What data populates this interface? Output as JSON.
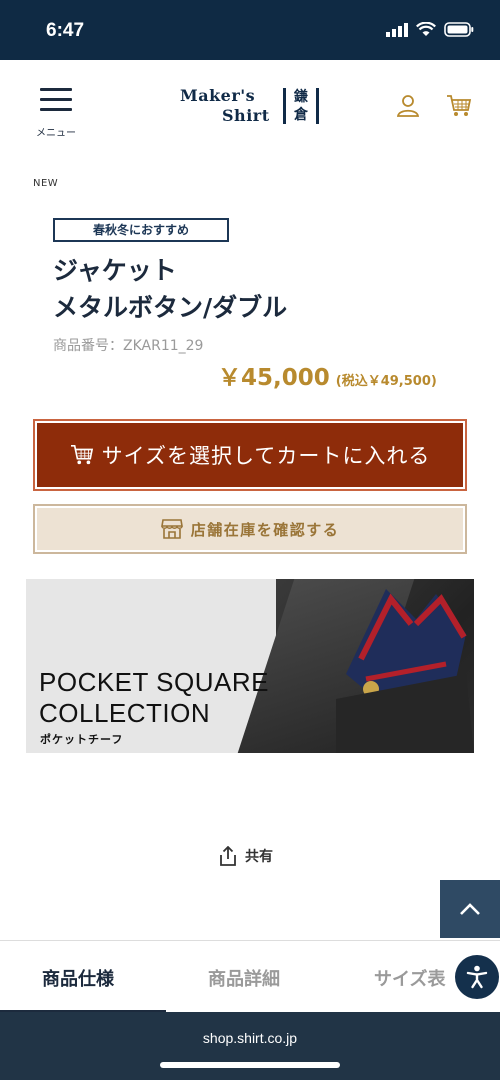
{
  "status_bar": {
    "time": "6:47"
  },
  "header": {
    "menu_label": "メニュー",
    "logo_line1": "Maker's",
    "logo_line2": "Shirt",
    "logo_kanji1": "鎌",
    "logo_kanji2": "倉"
  },
  "product": {
    "tag": "NEW",
    "season_badge": "春秋冬におすすめ",
    "title_line1": "ジャケット",
    "title_line2": "メタルボタン/ダブル",
    "code": "商品番号：ZKAR11_29",
    "price": "￥45,000",
    "price_tax": "(税込￥49,500)"
  },
  "buttons": {
    "add_to_cart": "サイズを選択してカートに入れる",
    "store_stock": "店舗在庫を確認する"
  },
  "banner": {
    "headline_line1": "POCKET SQUARE",
    "headline_line2": "COLLECTION",
    "sub": "ポケットチーフ"
  },
  "share": {
    "label": "共有"
  },
  "tabs": [
    {
      "label": "商品仕様",
      "active": true
    },
    {
      "label": "商品詳細",
      "active": false
    },
    {
      "label": "サイズ表",
      "active": false
    }
  ],
  "browser": {
    "url": "shop.shirt.co.jp"
  },
  "colors": {
    "navy": "#0f2a44",
    "cart_button": "#8e2c0a",
    "price_gold": "#b88a2e",
    "store_button_bg": "#ede2d3"
  },
  "icons": [
    "menu-icon",
    "user-icon",
    "cart-icon",
    "store-icon",
    "share-icon",
    "chevron-up-icon",
    "accessibility-icon"
  ]
}
